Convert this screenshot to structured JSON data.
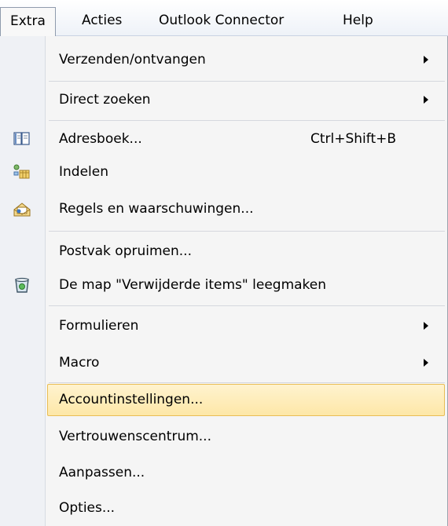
{
  "menubar": {
    "items": [
      {
        "label": "Extra",
        "active": true
      },
      {
        "label": "Acties"
      },
      {
        "label": "Outlook Connector"
      },
      {
        "label": "Help"
      }
    ]
  },
  "menu": {
    "items": [
      {
        "label": "Verzenden/ontvangen",
        "submenu": true
      },
      {
        "label": "Direct zoeken",
        "submenu": true
      },
      {
        "label": "Adresboek...",
        "shortcut": "Ctrl+Shift+B",
        "icon": "address-book-icon"
      },
      {
        "label": "Indelen",
        "icon": "organize-icon"
      },
      {
        "label": "Regels en waarschuwingen...",
        "icon": "rules-alerts-icon"
      },
      {
        "label": "Postvak opruimen..."
      },
      {
        "label": "De map \"Verwijderde items\" leegmaken",
        "icon": "empty-trash-icon"
      },
      {
        "label": "Formulieren",
        "submenu": true
      },
      {
        "label": "Macro",
        "submenu": true
      },
      {
        "label": "Accountinstellingen...",
        "highlighted": true
      },
      {
        "label": "Vertrouwenscentrum..."
      },
      {
        "label": "Aanpassen..."
      },
      {
        "label": "Opties..."
      }
    ]
  },
  "colors": {
    "highlight_fill": "#fde7a7",
    "highlight_border": "#e9bd54",
    "menu_background": "#f5f5f5"
  }
}
